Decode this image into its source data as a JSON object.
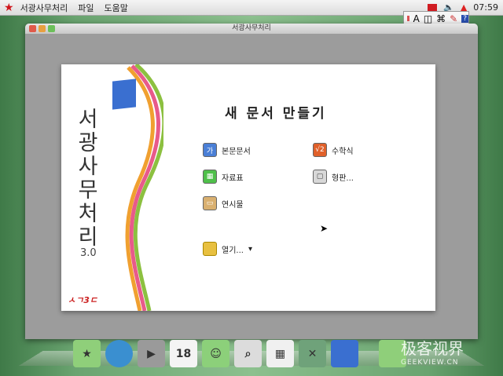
{
  "menubar": {
    "app": "서광사무처리",
    "menus": [
      "파일",
      "도움말"
    ],
    "clock": "07:59"
  },
  "ime": {
    "letter": "A"
  },
  "window": {
    "title": "서광사무처리"
  },
  "brand": {
    "name": "서광사무처리",
    "version": "3.0",
    "logo": "ㅅㄱ3ㄷ"
  },
  "dialog": {
    "heading": "새 문서 만들기",
    "items": [
      {
        "label": "본문문서",
        "icon": "text-doc-icon",
        "glyph": "가",
        "color": "#4a7fd6"
      },
      {
        "label": "수학식",
        "icon": "math-icon",
        "glyph": "√2",
        "color": "#e0602a"
      },
      {
        "label": "자료표",
        "icon": "table-icon",
        "glyph": "▦",
        "color": "#4fc04a"
      },
      {
        "label": "형판...",
        "icon": "template-icon",
        "glyph": "▢",
        "color": "#d8d8d8"
      },
      {
        "label": "연시물",
        "icon": "presentation-icon",
        "glyph": "▭",
        "color": "#d9b070"
      }
    ],
    "open": "열기..."
  },
  "dock": [
    {
      "name": "files",
      "glyph": "★",
      "color": "#8fcf7a"
    },
    {
      "name": "browser",
      "glyph": "",
      "color": "#3a8fd0"
    },
    {
      "name": "video",
      "glyph": "▶",
      "color": "#9a9a9a"
    },
    {
      "name": "calendar",
      "glyph": "18",
      "color": "#f4f4f4"
    },
    {
      "name": "contacts",
      "glyph": "☺",
      "color": "#8cd07a"
    },
    {
      "name": "search",
      "glyph": "⌕",
      "color": "#dcdcdc"
    },
    {
      "name": "calculator",
      "glyph": "▦",
      "color": "#f0f0f0"
    },
    {
      "name": "settings",
      "glyph": "✕",
      "color": "#6fa27a"
    },
    {
      "name": "office",
      "glyph": "",
      "color": "#3a6fd0"
    },
    {
      "name": "trash",
      "glyph": "",
      "color": "#8fcf7a"
    }
  ],
  "watermark": {
    "cn": "极客视界",
    "url": "GEEKVIEW.CN"
  }
}
